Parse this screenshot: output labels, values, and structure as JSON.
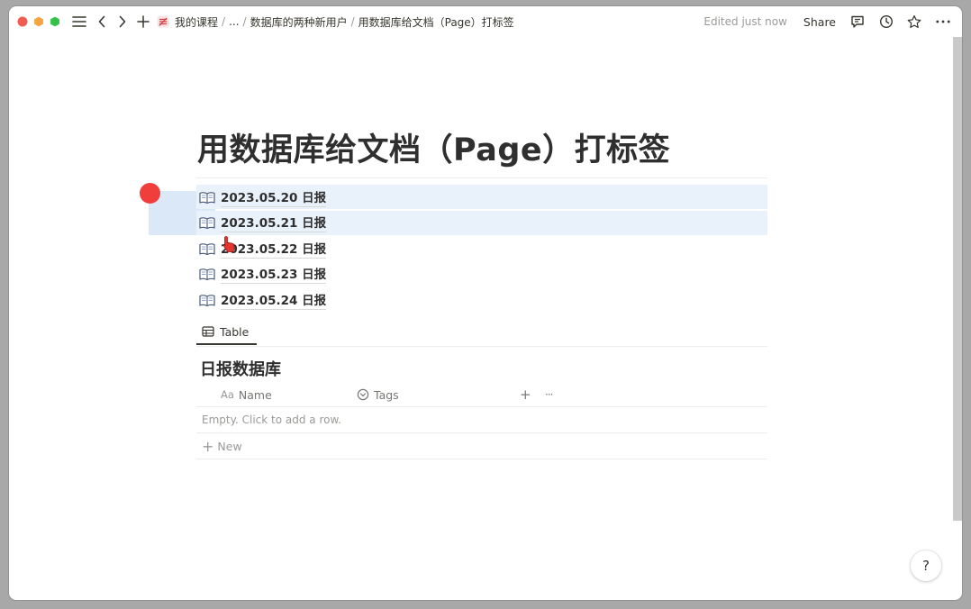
{
  "window": {
    "traffic_lights": {
      "close": "#ee5c52",
      "minimize": "#f5a544",
      "maximize": "#34c244"
    }
  },
  "breadcrumb": {
    "items": [
      "我的课程",
      "...",
      "数据库的两种新用户",
      "用数据库给文档（Page）打标签"
    ],
    "separator": "/"
  },
  "toolbar": {
    "edited": "Edited just now",
    "share": "Share",
    "icons": [
      "sidebar-toggle-icon",
      "back-icon",
      "forward-icon",
      "new-page-icon",
      "comment-icon",
      "history-icon",
      "favorite-star-icon",
      "more-icon"
    ]
  },
  "page": {
    "title": "用数据库给文档（Page）打标签",
    "linked_pages": [
      {
        "icon": "book-icon",
        "label": "2023.05.20 日报",
        "selected": true
      },
      {
        "icon": "book-icon",
        "label": "2023.05.21 日报",
        "selected": true
      },
      {
        "icon": "book-icon",
        "label": "2023.05.22 日报",
        "selected": false
      },
      {
        "icon": "book-icon",
        "label": "2023.05.23 日报",
        "selected": false
      },
      {
        "icon": "book-icon",
        "label": "2023.05.24 日报",
        "selected": false
      }
    ]
  },
  "database": {
    "view_tab": "Table",
    "title": "日报数据库",
    "columns": [
      {
        "type_icon": "Aa",
        "name": "Name"
      },
      {
        "type_icon": "select-icon",
        "name": "Tags"
      }
    ],
    "add_column": "+",
    "more": "···",
    "empty_text": "Empty. Click to add a row.",
    "new_label": "New"
  },
  "help": {
    "label": "?"
  },
  "colors": {
    "selection": "#e9f1fb",
    "drag_box": "#cfe0f6",
    "cursor_dot": "#ef3e3c",
    "text": "#37352f",
    "muted": "#9b9a97"
  }
}
